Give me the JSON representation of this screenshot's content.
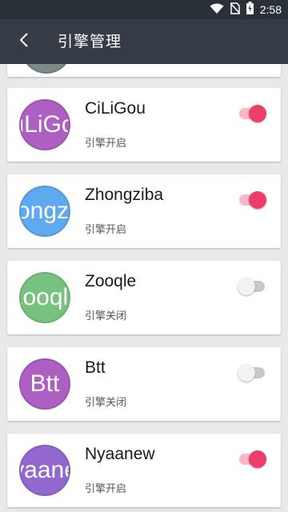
{
  "status_bar": {
    "time": "2:58",
    "icons": [
      "wifi-icon",
      "no-sim-icon",
      "battery-charging-icon"
    ]
  },
  "app_bar": {
    "title": "引擎管理",
    "back_icon": "back-arrow-icon"
  },
  "colors": {
    "app_bar_bg": "#353c45",
    "status_bar_bg": "#2a3038",
    "accent_on": "#ef3d6b",
    "track_on": "#f9b7c8"
  },
  "engines": [
    {
      "name": "CiLiGou",
      "avatar_text": "CiLiGou",
      "status": "引擎开启",
      "enabled": true,
      "avatar_color": "#ad5fc2"
    },
    {
      "name": "Zhongziba",
      "avatar_text": "Zhongziba",
      "status": "引擎开启",
      "enabled": true,
      "avatar_color": "#5fa9ef"
    },
    {
      "name": "Zooqle",
      "avatar_text": "Zooqle",
      "status": "引擎关闭",
      "enabled": false,
      "avatar_color": "#78c27f"
    },
    {
      "name": "Btt",
      "avatar_text": "Btt",
      "status": "引擎关闭",
      "enabled": false,
      "avatar_color": "#ad5fc2"
    },
    {
      "name": "Nyaanew",
      "avatar_text": "Nyaanew",
      "status": "引擎开启",
      "enabled": true,
      "avatar_color": "#9268cf"
    }
  ]
}
